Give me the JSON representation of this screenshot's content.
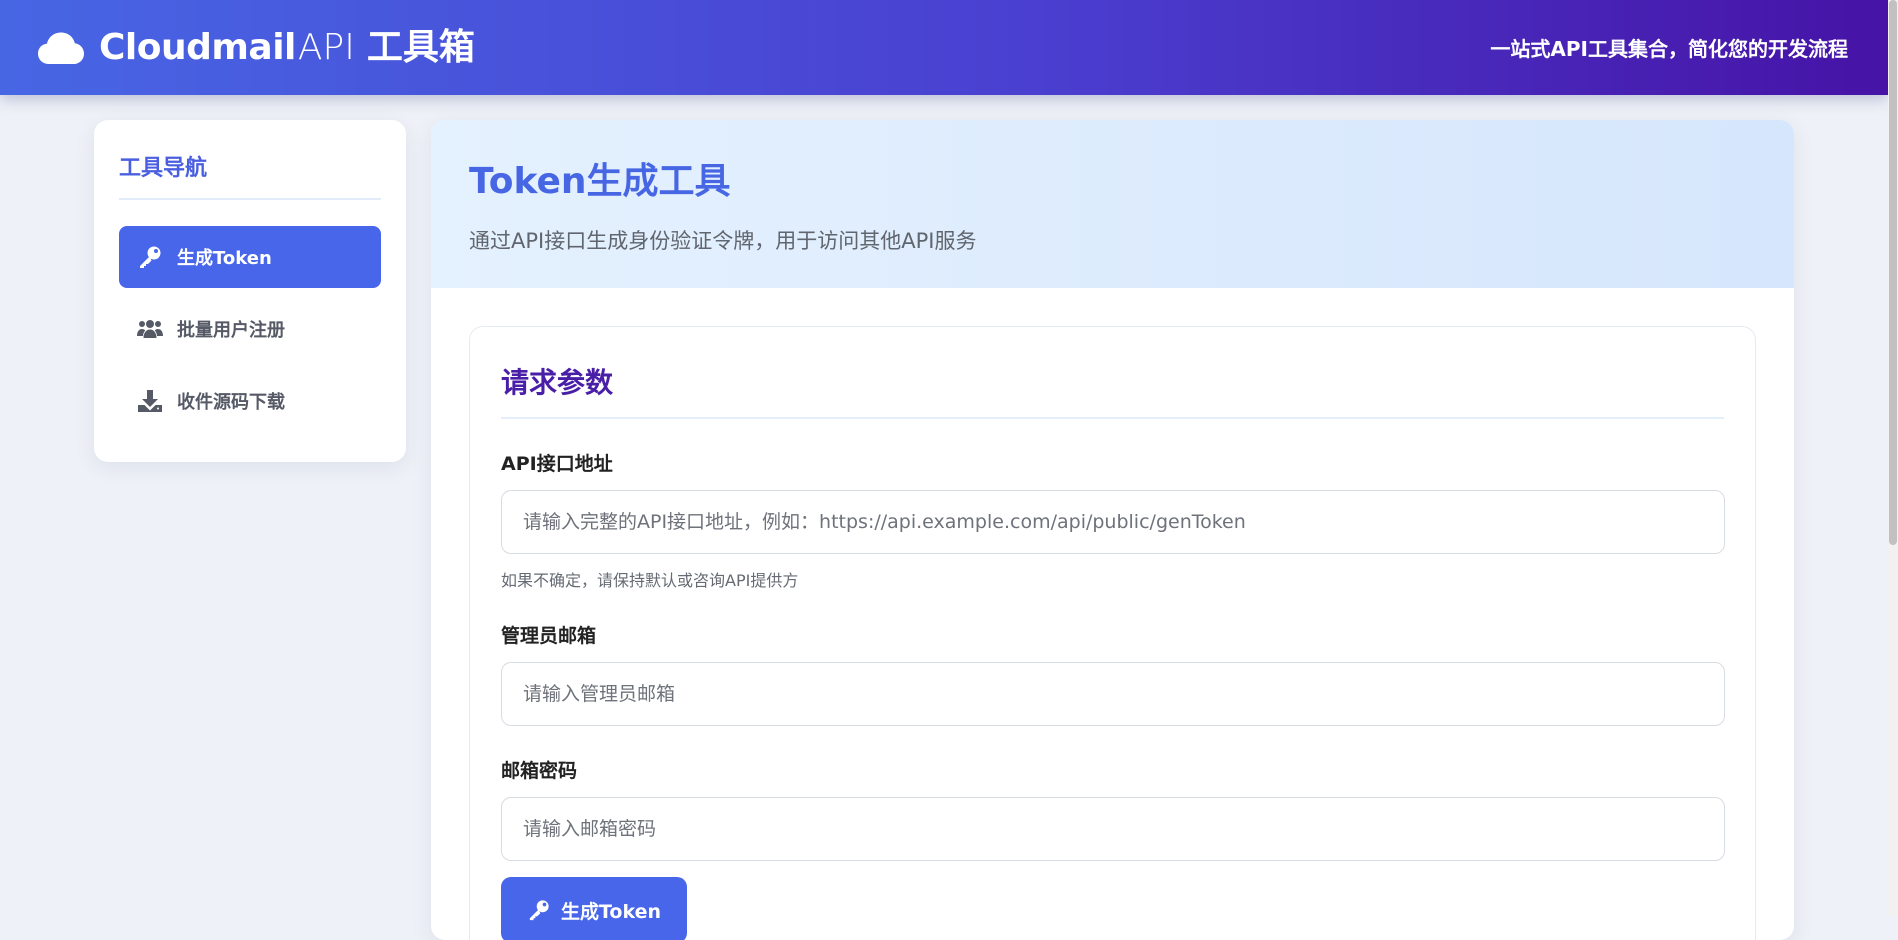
{
  "header": {
    "brand_strong": "Cloudmail",
    "brand_light": "API",
    "brand_tool": "工具箱",
    "tagline": "一站式API工具集合，简化您的开发流程",
    "cloud_icon": "cloud-icon"
  },
  "sidebar": {
    "title": "工具导航",
    "items": [
      {
        "label": "生成Token",
        "icon": "key-icon",
        "active": true
      },
      {
        "label": "批量用户注册",
        "icon": "users-icon",
        "active": false
      },
      {
        "label": "收件源码下载",
        "icon": "download-icon",
        "active": false
      }
    ]
  },
  "main": {
    "title": "Token生成工具",
    "subtitle": "通过API接口生成身份验证令牌，用于访问其他API服务",
    "section_title": "请求参数",
    "fields": [
      {
        "label": "API接口地址",
        "value": "",
        "placeholder": "请输入完整的API接口地址，例如：https://api.example.com/api/public/genToken",
        "hint": "如果不确定，请保持默认或咨询API提供方"
      },
      {
        "label": "管理员邮箱",
        "value": "",
        "placeholder": "请输入管理员邮箱"
      },
      {
        "label": "邮箱密码",
        "value": "",
        "placeholder": "请输入邮箱密码"
      }
    ],
    "submit_label": "生成Token"
  },
  "colors": {
    "accent": "#4766ea",
    "header_start": "#4766e4",
    "header_end": "#4613a6",
    "section_title": "#4a1fa8"
  }
}
